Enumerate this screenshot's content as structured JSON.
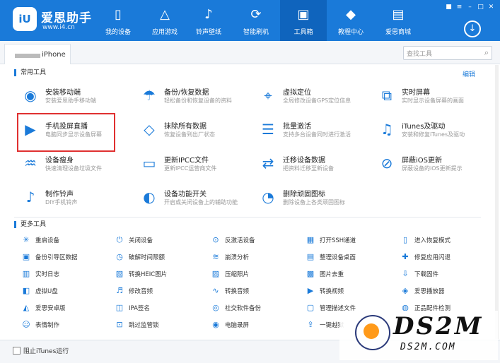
{
  "header": {
    "logo_text": "iU",
    "brand": "爱思助手",
    "url": "www.i4.cn",
    "nav": [
      {
        "label": "我的设备",
        "icon": "phone-icon"
      },
      {
        "label": "应用游戏",
        "icon": "apps-icon"
      },
      {
        "label": "铃声壁纸",
        "icon": "music-icon"
      },
      {
        "label": "智能刷机",
        "icon": "flash-icon"
      },
      {
        "label": "工具箱",
        "icon": "toolbox-icon"
      },
      {
        "label": "教程中心",
        "icon": "graduation-icon"
      },
      {
        "label": "爱思商城",
        "icon": "store-icon"
      }
    ],
    "active_tab": "工具箱"
  },
  "tabbar": {
    "device_name": "iPhone",
    "search_placeholder": "查找工具"
  },
  "common_tools": {
    "title": "常用工具",
    "edit": "编辑",
    "items": [
      {
        "name": "安装移动端",
        "desc": "安装爱思助手移动端",
        "icon": "install-mobile-icon"
      },
      {
        "name": "备份/恢复数据",
        "desc": "轻松备份和恢复设备的资料",
        "icon": "umbrella-icon"
      },
      {
        "name": "虚拟定位",
        "desc": "全局修改设备GPS定位信息",
        "icon": "location-pin-icon"
      },
      {
        "name": "实时屏幕",
        "desc": "实时显示设备屏幕的画面",
        "icon": "screen-mirror-icon"
      },
      {
        "name": "手机投屏直播",
        "desc": "电脑同步显示设备屏幕",
        "icon": "screen-cast-icon"
      },
      {
        "name": "抹除所有数据",
        "desc": "恢复设备到出厂状态",
        "icon": "eraser-icon"
      },
      {
        "name": "批量激活",
        "desc": "支持多台设备同时进行激活",
        "icon": "batch-activate-icon"
      },
      {
        "name": "iTunes及驱动",
        "desc": "安装和修复iTunes及驱动",
        "icon": "itunes-icon"
      },
      {
        "name": "设备瘦身",
        "desc": "快速清理设备垃圾文件",
        "icon": "broom-icon"
      },
      {
        "name": "更新IPCC文件",
        "desc": "更新IPCC运营商文件",
        "icon": "ipcc-file-icon"
      },
      {
        "name": "迁移设备数据",
        "desc": "把资料迁移至新设备",
        "icon": "migrate-icon"
      },
      {
        "name": "屏蔽iOS更新",
        "desc": "屏蔽设备的iOS更新提示",
        "icon": "block-update-icon"
      },
      {
        "name": "制作铃声",
        "desc": "DIY手机铃声",
        "icon": "ringtone-bell-icon"
      },
      {
        "name": "设备功能开关",
        "desc": "开启或关闭设备上的辅助功能",
        "icon": "toggle-switch-icon"
      },
      {
        "name": "删除顽固图标",
        "desc": "删除设备上各类顽固图标",
        "icon": "pie-chart-icon"
      }
    ]
  },
  "more_tools": {
    "title": "更多工具",
    "items": [
      {
        "name": "重启设备",
        "icon": "restart-icon"
      },
      {
        "name": "关闭设备",
        "icon": "power-icon"
      },
      {
        "name": "反激活设备",
        "icon": "deactivate-icon"
      },
      {
        "name": "打开SSH通道",
        "icon": "ssh-icon"
      },
      {
        "name": "进入恢复模式",
        "icon": "recovery-icon"
      },
      {
        "name": "备份引导区数据",
        "icon": "backup-boot-icon"
      },
      {
        "name": "破解时间限额",
        "icon": "timer-icon"
      },
      {
        "name": "崩溃分析",
        "icon": "crash-icon"
      },
      {
        "name": "整理设备桌面",
        "icon": "desktop-icon"
      },
      {
        "name": "修复应用闪退",
        "icon": "repair-icon"
      },
      {
        "name": "实时日志",
        "icon": "log-icon"
      },
      {
        "name": "转换HEIC图片",
        "icon": "heic-icon"
      },
      {
        "name": "压缩照片",
        "icon": "compress-icon"
      },
      {
        "name": "图片去重",
        "icon": "dedupe-icon"
      },
      {
        "name": "下载固件",
        "icon": "download-firmware-icon"
      },
      {
        "name": "虚拟U盘",
        "icon": "usb-icon"
      },
      {
        "name": "修改音频",
        "icon": "audio-edit-icon"
      },
      {
        "name": "转换音频",
        "icon": "audio-convert-icon"
      },
      {
        "name": "转换视频",
        "icon": "video-convert-icon"
      },
      {
        "name": "爱思播放器",
        "icon": "player-icon"
      },
      {
        "name": "爱思安卓版",
        "icon": "android-icon"
      },
      {
        "name": "IPA签名",
        "icon": "ipa-icon"
      },
      {
        "name": "社交软件备份",
        "icon": "social-backup-icon"
      },
      {
        "name": "管理描述文件",
        "icon": "profile-icon"
      },
      {
        "name": "正品配件检测",
        "icon": "accessory-icon"
      },
      {
        "name": "表情制作",
        "icon": "emoji-icon"
      },
      {
        "name": "跳过监管锁",
        "icon": "lock-skip-icon"
      },
      {
        "name": "电脑录屏",
        "icon": "screen-record-icon"
      },
      {
        "name": "一键越狱",
        "icon": "jailbreak-icon"
      }
    ]
  },
  "footer": {
    "checkbox_label": "阻止iTunes运行"
  },
  "watermark": {
    "title": "DS2M",
    "subtitle": "DS2M.COM"
  },
  "colors": {
    "header_bg": "#1a7ad9",
    "active_nav_bg": "#0f64bd",
    "highlight": "#e03030",
    "accent": "#1a7ad9"
  }
}
